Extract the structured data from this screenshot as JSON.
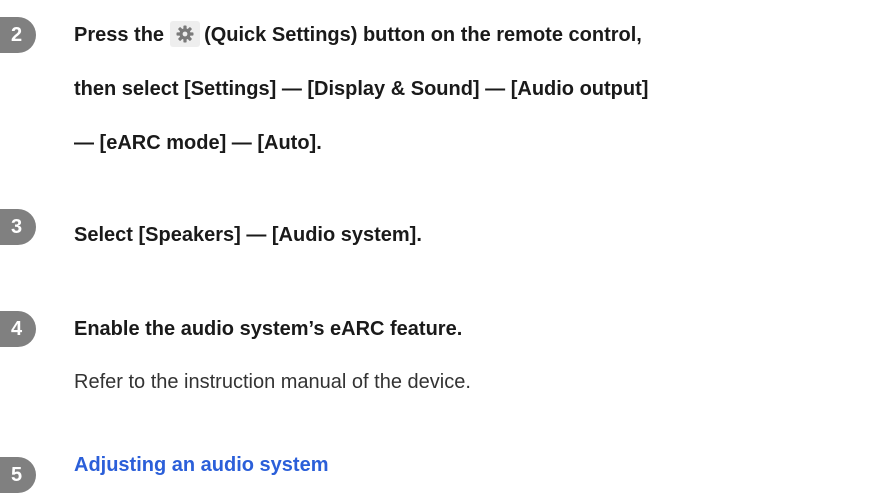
{
  "steps": [
    {
      "number": "2",
      "lines": {
        "l1_before": "Press the",
        "l1_after": "(Quick Settings) button on the remote control,",
        "l2": "then select [Settings] — [Display & Sound] — [Audio output]",
        "l3": "— [eARC mode] — [Auto]."
      },
      "icon": "quick-settings-gear-icon"
    },
    {
      "number": "3",
      "title": "Select [Speakers] — [Audio system]."
    },
    {
      "number": "4",
      "title": "Enable the audio system’s eARC feature.",
      "body": "Refer to the instruction manual of the device."
    },
    {
      "number": "5",
      "link": "Adjusting an audio system"
    }
  ],
  "colors": {
    "badge": "#808080",
    "link": "#2b5fd9",
    "icon_bg": "#eeeeee"
  }
}
